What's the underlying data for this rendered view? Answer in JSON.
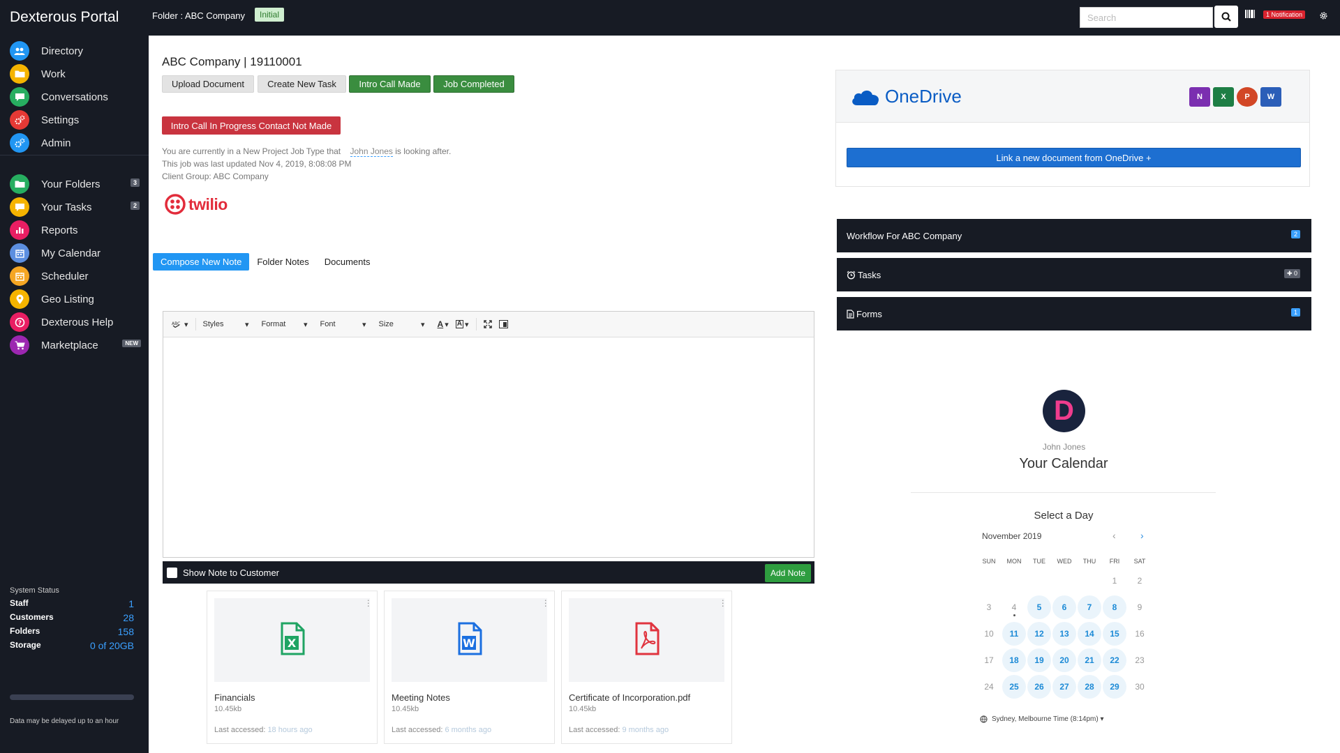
{
  "topbar": {
    "brand": "Dexterous Portal",
    "folder_title": "Folder : ABC Company",
    "status": "Initial",
    "search_placeholder": "Search",
    "notification": "1 Notification"
  },
  "sidebar": {
    "items": [
      {
        "label": "Directory",
        "color": "#2196f3",
        "icon": "users-icon"
      },
      {
        "label": "Work",
        "color": "#f5b400",
        "icon": "folder-icon"
      },
      {
        "label": "Conversations",
        "color": "#27ae60",
        "icon": "chat-icon"
      },
      {
        "label": "Settings",
        "color": "#e53935",
        "icon": "gears-icon"
      },
      {
        "label": "Admin",
        "color": "#2196f3",
        "icon": "gears-icon"
      }
    ],
    "items2": [
      {
        "label": "Your Folders",
        "color": "#27ae60",
        "badge": "3",
        "icon": "folder-icon"
      },
      {
        "label": "Your Tasks",
        "color": "#f5b400",
        "badge": "2",
        "icon": "chat-icon"
      },
      {
        "label": "Reports",
        "color": "#e91e63",
        "icon": "chart-icon"
      },
      {
        "label": "My Calendar",
        "color": "#5c8fe0",
        "icon": "calendar-icon"
      },
      {
        "label": "Scheduler",
        "color": "#f5a623",
        "icon": "calendar-icon"
      },
      {
        "label": "Geo Listing",
        "color": "#f5b400",
        "icon": "map-pin-icon"
      },
      {
        "label": "Dexterous Help",
        "color": "#e91e63",
        "icon": "help-icon"
      },
      {
        "label": "Marketplace",
        "color": "#9c27b0",
        "badge": "NEW",
        "icon": "cart-icon"
      }
    ],
    "system_status": {
      "heading": "System Status",
      "rows": [
        {
          "key": "Staff",
          "value": "1"
        },
        {
          "key": "Customers",
          "value": "28"
        },
        {
          "key": "Folders",
          "value": "158"
        },
        {
          "key": "Storage",
          "value": "0 of 20GB"
        }
      ],
      "storage_used_fraction": 0.0,
      "note": "Data may be delayed up to an hour"
    }
  },
  "main": {
    "title": "ABC Company | 19110001",
    "buttons": {
      "upload": "Upload Document",
      "new_task": "Create New Task",
      "intro_call": "Intro Call Made",
      "job_completed": "Job Completed"
    },
    "intro_status": "Intro Call In Progress Contact Not Made",
    "info_pre": "You are currently in a New Project Job Type that",
    "info_user": "John Jones",
    "info_post": "is looking after.",
    "updated": "This job was last updated Nov 4, 2019, 8:08:08 PM",
    "client_group": "Client Group: ABC Company",
    "twilio_logo": "twilio",
    "tabs": [
      "Compose New Note",
      "Folder Notes",
      "Documents"
    ],
    "editor": {
      "styles": "Styles",
      "format": "Format",
      "font": "Font",
      "size": "Size"
    },
    "show_note": "Show Note to Customer",
    "add_note": "Add Note",
    "documents": [
      {
        "name": "Financials",
        "size": "10.45kb",
        "accessed_label": "Last accessed:",
        "ago": "18 hours ago",
        "type": "excel-file-icon",
        "color": "#1fa463"
      },
      {
        "name": "Meeting Notes",
        "size": "10.45kb",
        "accessed_label": "Last accessed:",
        "ago": "6 months ago",
        "type": "word-file-icon",
        "color": "#1b6fe0"
      },
      {
        "name": "Certificate of Incorporation.pdf",
        "size": "10.45kb",
        "accessed_label": "Last accessed:",
        "ago": "9 months ago",
        "type": "pdf-file-icon",
        "color": "#e0343f"
      }
    ]
  },
  "right": {
    "onedrive_logo": "OneDrive",
    "onedrive_link": "Link a new document from OneDrive +",
    "office_apps": [
      {
        "letter": "N",
        "color": "#7b2fb0"
      },
      {
        "letter": "X",
        "color": "#1e7e45"
      },
      {
        "letter": "P",
        "color": "#d24726"
      },
      {
        "letter": "W",
        "color": "#2b5eb8"
      }
    ],
    "panels": [
      {
        "label": "Workflow For ABC Company",
        "badge": "2"
      },
      {
        "label": "Tasks",
        "badge": "✚ 0"
      },
      {
        "label": "Forms",
        "badge": "1"
      }
    ],
    "calendar": {
      "avatar_letter": "D",
      "user": "John Jones",
      "title": "Your Calendar",
      "select_day": "Select a Day",
      "month": "November 2019",
      "prev": "‹",
      "next": "›",
      "weekdays": [
        "SUN",
        "MON",
        "TUE",
        "WED",
        "THU",
        "FRI",
        "SAT"
      ],
      "weeks": [
        [
          {
            "d": ""
          },
          {
            "d": ""
          },
          {
            "d": ""
          },
          {
            "d": ""
          },
          {
            "d": ""
          },
          {
            "d": "1"
          },
          {
            "d": "2"
          }
        ],
        [
          {
            "d": "3"
          },
          {
            "d": "4",
            "today": true
          },
          {
            "d": "5",
            "avail": true
          },
          {
            "d": "6",
            "avail": true
          },
          {
            "d": "7",
            "avail": true
          },
          {
            "d": "8",
            "avail": true
          },
          {
            "d": "9"
          }
        ],
        [
          {
            "d": "10"
          },
          {
            "d": "11",
            "avail": true
          },
          {
            "d": "12",
            "avail": true
          },
          {
            "d": "13",
            "avail": true
          },
          {
            "d": "14",
            "avail": true
          },
          {
            "d": "15",
            "avail": true
          },
          {
            "d": "16"
          }
        ],
        [
          {
            "d": "17"
          },
          {
            "d": "18",
            "avail": true
          },
          {
            "d": "19",
            "avail": true
          },
          {
            "d": "20",
            "avail": true
          },
          {
            "d": "21",
            "avail": true
          },
          {
            "d": "22",
            "avail": true
          },
          {
            "d": "23"
          }
        ],
        [
          {
            "d": "24"
          },
          {
            "d": "25",
            "avail": true
          },
          {
            "d": "26",
            "avail": true
          },
          {
            "d": "27",
            "avail": true
          },
          {
            "d": "28",
            "avail": true
          },
          {
            "d": "29",
            "avail": true
          },
          {
            "d": "30"
          }
        ]
      ],
      "timezone": "Sydney, Melbourne Time (8:14pm) ▾"
    }
  }
}
